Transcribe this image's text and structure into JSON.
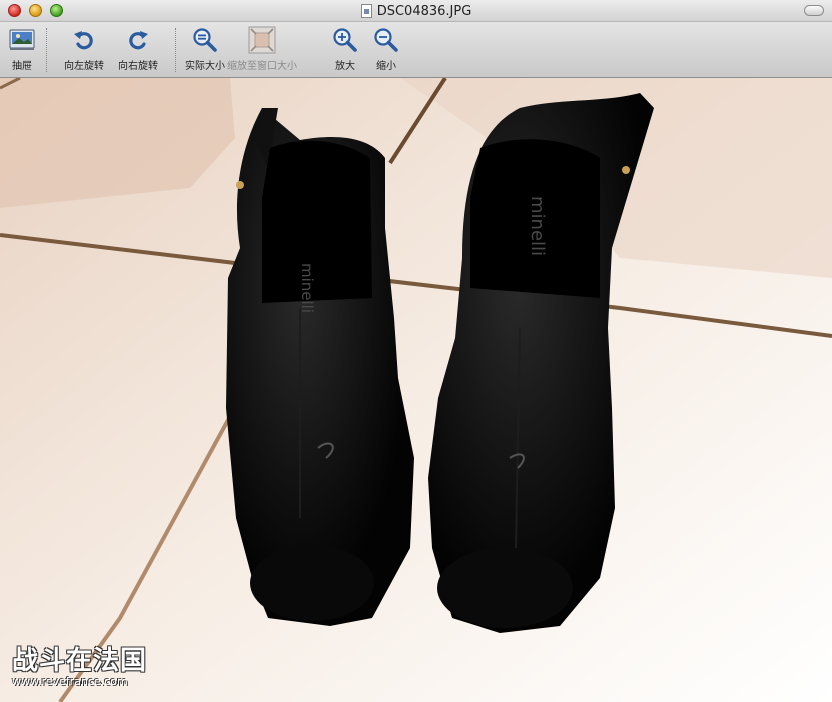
{
  "window": {
    "title": "DSC04836.JPG"
  },
  "toolbar": {
    "items": [
      {
        "label": "抽屉",
        "icon": "drawer-icon"
      },
      {
        "label": "向左旋转",
        "icon": "rotate-left-icon"
      },
      {
        "label": "向右旋转",
        "icon": "rotate-right-icon"
      },
      {
        "label": "实际大小",
        "icon": "actual-size-icon"
      },
      {
        "label": "缩放至窗口大小",
        "icon": "zoom-to-fit-icon",
        "disabled": true
      },
      {
        "label": "放大",
        "icon": "zoom-in-icon"
      },
      {
        "label": "缩小",
        "icon": "zoom-out-icon"
      }
    ]
  },
  "photo": {
    "shoe_brand_text": "minelli",
    "watermark_title": "战斗在法国",
    "watermark_url": "www.revefrance.com"
  },
  "colors": {
    "accent_icon": "#2a5b9e",
    "floor_tile": "#efddd0",
    "grout": "#7a5a3c",
    "shoe": "#050505"
  }
}
